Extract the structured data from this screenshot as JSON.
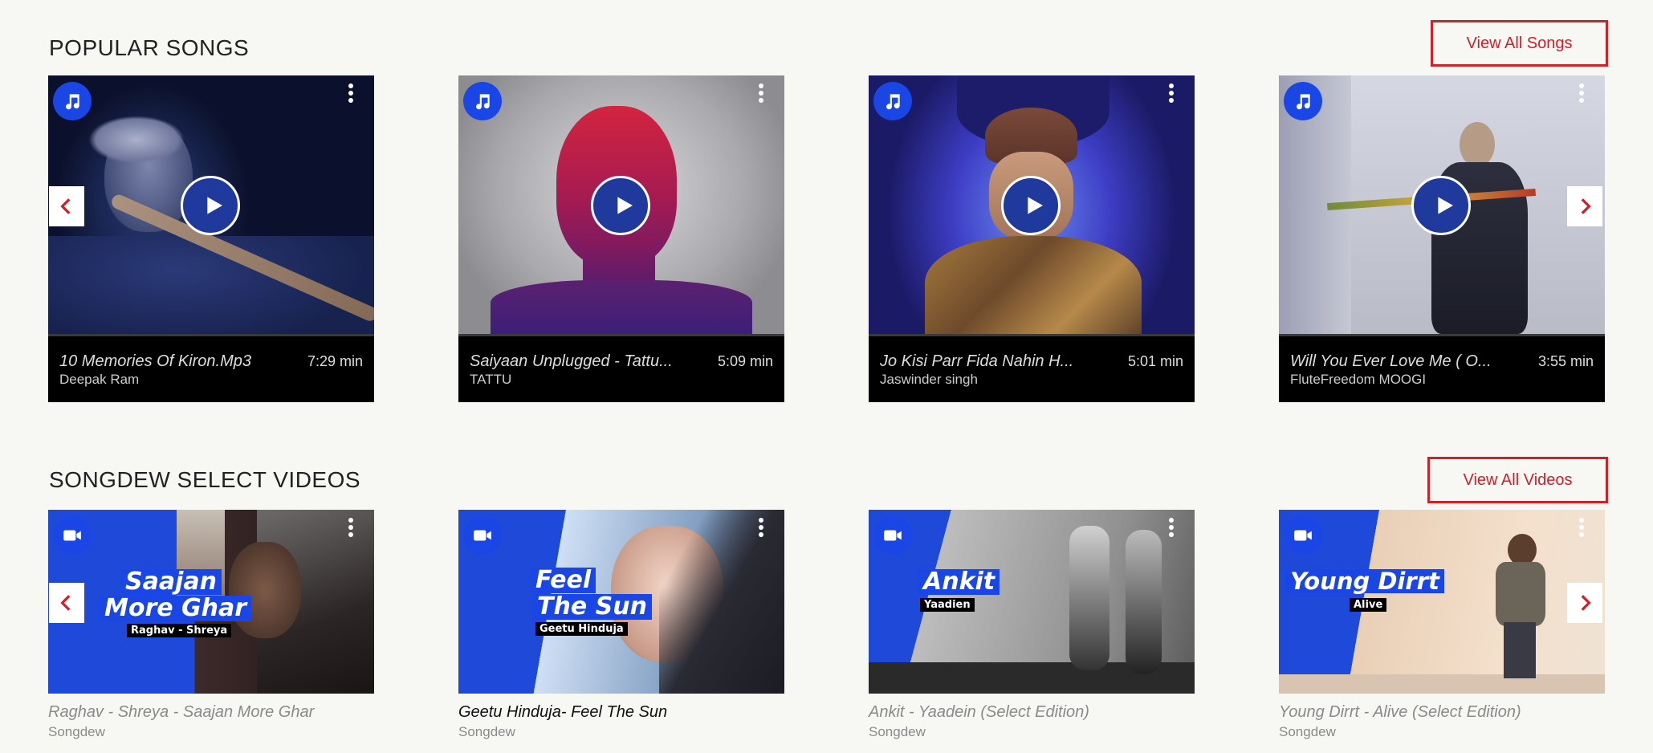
{
  "popular": {
    "title": "POPULAR SONGS",
    "view_all": "View All Songs",
    "items": [
      {
        "title": "10 Memories Of Kiron.Mp3",
        "duration": "7:29 min",
        "artist": "Deepak Ram"
      },
      {
        "title": "Saiyaan Unplugged - Tattu...",
        "duration": "5:09 min",
        "artist": "TATTU"
      },
      {
        "title": "Jo Kisi Parr Fida Nahin H...",
        "duration": "5:01 min",
        "artist": "Jaswinder singh"
      },
      {
        "title": "Will You Ever Love Me ( O...",
        "duration": "3:55 min",
        "artist": "FluteFreedom MOOGI"
      }
    ]
  },
  "videos": {
    "title": "SONGDEW SELECT VIDEOS",
    "view_all": "View All Videos",
    "items": [
      {
        "title": "Raghav - Shreya - Saajan More Ghar",
        "subtitle": "Songdew",
        "overlay_title_1": "Saajan",
        "overlay_title_2": "More Ghar",
        "overlay_sub": "Raghav - Shreya"
      },
      {
        "title": "Geetu Hinduja- Feel The Sun",
        "subtitle": "Songdew",
        "overlay_title_1": "Feel",
        "overlay_title_2": "The Sun",
        "overlay_sub": "Geetu Hinduja"
      },
      {
        "title": "Ankit - Yaadein (Select Edition)",
        "subtitle": "Songdew",
        "overlay_title_1": "Ankit",
        "overlay_sub": "Yaadien"
      },
      {
        "title": "Young Dirrt - Alive (Select Edition)",
        "subtitle": "Songdew",
        "overlay_title_1": "Young Dirrt",
        "overlay_sub": "Alive"
      }
    ]
  },
  "icons": {
    "song_badge": "music-note-icon",
    "video_badge": "video-camera-icon",
    "menu": "kebab-menu-icon",
    "play": "play-icon",
    "prev": "chevron-left-icon",
    "next": "chevron-right-icon"
  },
  "colors": {
    "accent_red": "#d0202a",
    "badge_blue": "#1a46e6",
    "play_blue": "#1f3a9c",
    "background": "#f7f7f3"
  }
}
